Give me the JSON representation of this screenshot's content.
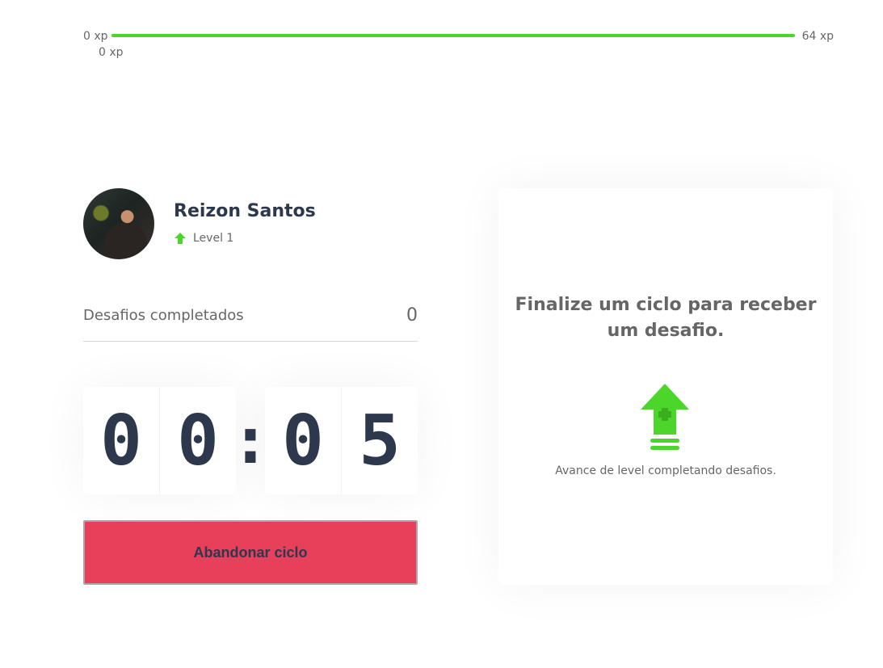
{
  "experience": {
    "min_label": "0 xp",
    "max_label": "64 xp",
    "current_label": "0 xp",
    "progress_fraction": 1.0
  },
  "profile": {
    "name": "Reizon Santos",
    "level_label": "Level 1"
  },
  "challenges": {
    "label": "Desafios completados",
    "count": "0"
  },
  "countdown": {
    "minute_left": "0",
    "minute_right": "0",
    "separator": ":",
    "second_left": "0",
    "second_right": "5"
  },
  "actions": {
    "abandon_label": "Abandonar ciclo"
  },
  "challenge_box": {
    "heading": "Finalize um ciclo para receber um desafio.",
    "hint": "Avance de level completando desafios."
  },
  "colors": {
    "accent_green": "#4cd62b",
    "danger_red": "#e83f5b",
    "title_dark": "#2e384d"
  },
  "icons": {
    "level": "level-up-arrow-icon",
    "challenge": "level-up-stack-icon"
  }
}
